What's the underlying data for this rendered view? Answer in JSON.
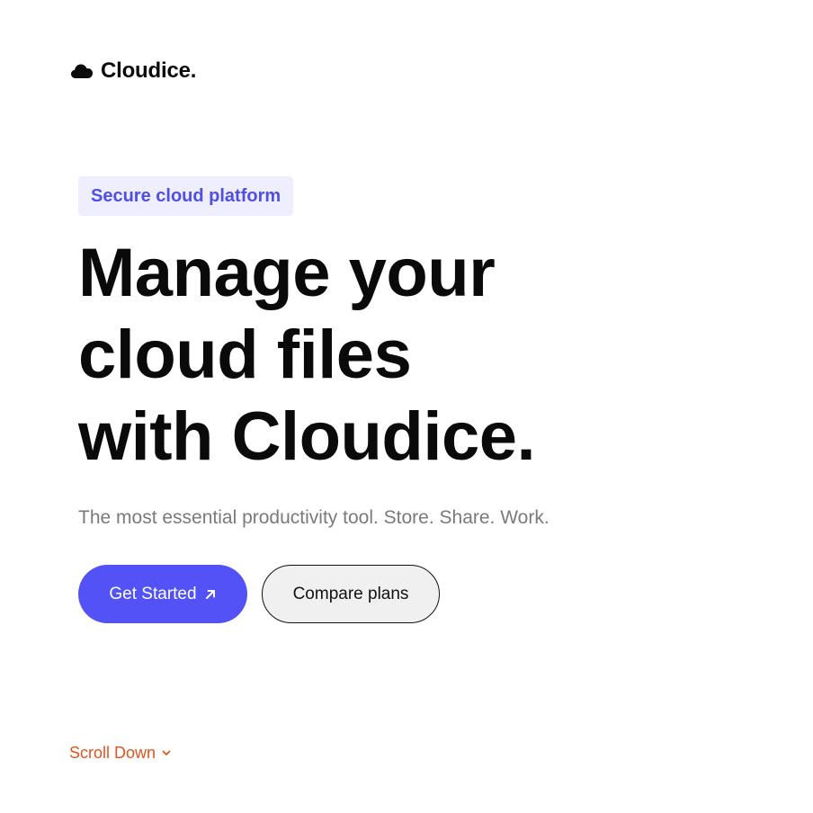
{
  "brand": {
    "name": "Cloudice.",
    "icon": "cloud-icon"
  },
  "hero": {
    "badge": "Secure cloud platform",
    "headline_lines": [
      "Manage your",
      "cloud files",
      "with Cloudice."
    ],
    "subtitle": "The most essential productivity tool. Store. Share. Work."
  },
  "actions": {
    "primary_label": "Get Started",
    "primary_icon": "arrow-up-right-icon",
    "secondary_label": "Compare plans"
  },
  "scroll": {
    "label": "Scroll Down",
    "icon": "chevron-down-icon"
  },
  "colors": {
    "accent": "#5252f7",
    "badge_bg": "#eeeefe",
    "badge_text": "#4f4fe6",
    "scroll_text": "#e2531f",
    "subtitle_text": "#7a7a7a"
  }
}
